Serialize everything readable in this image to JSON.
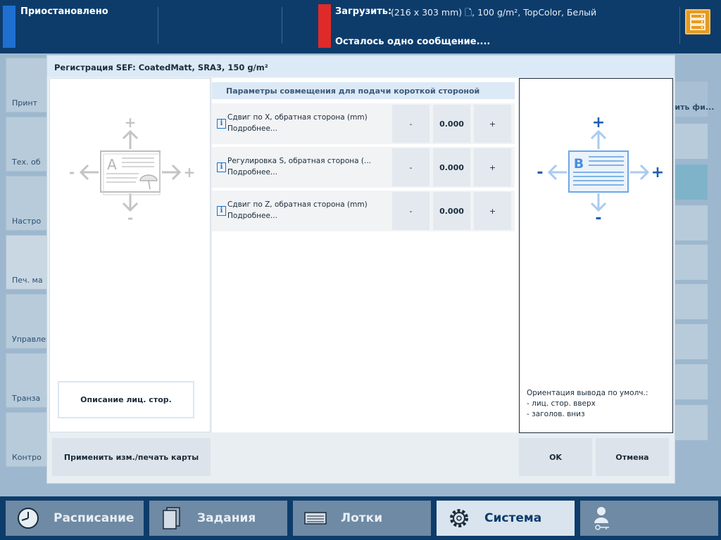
{
  "topbar": {
    "status": "Приостановлено",
    "load_label": "Загрузить:",
    "load_value": "(216 x 303 mm) 🗋, 100 g/m², TopColor, Белый",
    "message": "Осталось одно сообщение....",
    "server_icon": "server-icon",
    "colors": {
      "status": "#1f6fd0",
      "alert": "#e02a2a",
      "server": "#e79b1d"
    }
  },
  "background": {
    "side_items": [
      "Принт",
      "Тех. об",
      "Настро",
      "Печ. ма",
      "Управлен",
      "Транза",
      "Контро"
    ],
    "right_items": [
      "тить фи..."
    ]
  },
  "dialog": {
    "title": "Регистрация SEF: CoatedMatt, SRA3, 150 g/m²",
    "description_button": "Описание лиц. стор.",
    "params_header": "Параметры совмещения для подачи короткой стороной",
    "params": [
      {
        "name": "Сдвиг по X, обратная сторона (mm)",
        "more": "Подробнее...",
        "minus": "-",
        "value": "0.000",
        "plus": "+"
      },
      {
        "name": "Регулировка S, обратная сторона (...",
        "more": "Подробнее...",
        "minus": "-",
        "value": "0.000",
        "plus": "+"
      },
      {
        "name": "Сдвиг по Z, обратная сторона (mm)",
        "more": "Подробнее...",
        "minus": "-",
        "value": "0.000",
        "plus": "+"
      }
    ],
    "front_diagram": {
      "letter": "A",
      "minus": "-",
      "plus": "+"
    },
    "back_diagram": {
      "letter": "B",
      "minus": "-",
      "plus": "+"
    },
    "orientation_lines": [
      "Ориентация вывода по умолч.:",
      "- лиц. стор. вверх",
      "- заголов. вниз"
    ],
    "apply_button": "Применить изм./печать карты",
    "ok_button": "OK",
    "cancel_button": "Отмена"
  },
  "bottom_nav": [
    {
      "label": "Расписание",
      "icon": "clock-icon",
      "active": false
    },
    {
      "label": "Задания",
      "icon": "jobs-icon",
      "active": false
    },
    {
      "label": "Лотки",
      "icon": "trays-icon",
      "active": false
    },
    {
      "label": "Система",
      "icon": "gear-icon",
      "active": true
    },
    {
      "label": "",
      "icon": "user-key-icon",
      "active": false
    }
  ]
}
